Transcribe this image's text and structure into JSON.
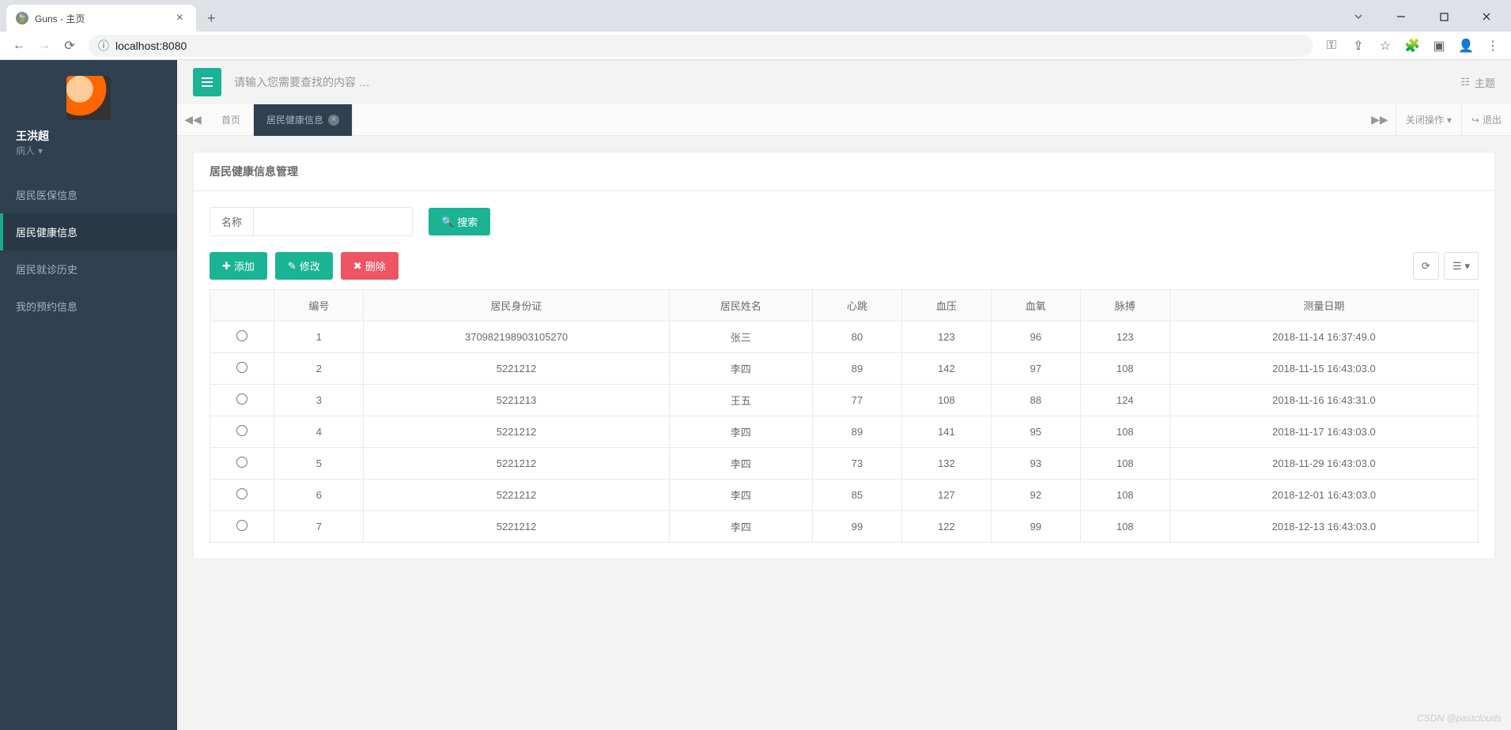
{
  "browser": {
    "tab_title": "Guns - 主页",
    "url": "localhost:8080"
  },
  "sidebar": {
    "username": "王洪超",
    "role": "病人",
    "items": [
      {
        "label": "居民医保信息",
        "active": false
      },
      {
        "label": "居民健康信息",
        "active": true
      },
      {
        "label": "居民就诊历史",
        "active": false
      },
      {
        "label": "我的预约信息",
        "active": false
      }
    ]
  },
  "topbar": {
    "search_placeholder": "请输入您需要查找的内容 …",
    "theme_label": "主题"
  },
  "tabs": {
    "home_label": "首页",
    "active_label": "居民健康信息",
    "close_ops_label": "关闭操作",
    "logout_label": "退出"
  },
  "panel": {
    "title": "居民健康信息管理",
    "search_label": "名称",
    "search_button": "搜索",
    "add_button": "添加",
    "edit_button": "修改",
    "delete_button": "删除"
  },
  "table": {
    "headers": [
      "编号",
      "居民身份证",
      "居民姓名",
      "心跳",
      "血压",
      "血氧",
      "脉搏",
      "测量日期"
    ],
    "rows": [
      {
        "id": "1",
        "idcard": "370982198903105270",
        "name": "张三",
        "heart": "80",
        "bp": "123",
        "spo2": "96",
        "pulse": "123",
        "date": "2018-11-14 16:37:49.0"
      },
      {
        "id": "2",
        "idcard": "5221212",
        "name": "李四",
        "heart": "89",
        "bp": "142",
        "spo2": "97",
        "pulse": "108",
        "date": "2018-11-15 16:43:03.0"
      },
      {
        "id": "3",
        "idcard": "5221213",
        "name": "王五",
        "heart": "77",
        "bp": "108",
        "spo2": "88",
        "pulse": "124",
        "date": "2018-11-16 16:43:31.0"
      },
      {
        "id": "4",
        "idcard": "5221212",
        "name": "李四",
        "heart": "89",
        "bp": "141",
        "spo2": "95",
        "pulse": "108",
        "date": "2018-11-17 16:43:03.0"
      },
      {
        "id": "5",
        "idcard": "5221212",
        "name": "李四",
        "heart": "73",
        "bp": "132",
        "spo2": "93",
        "pulse": "108",
        "date": "2018-11-29 16:43:03.0"
      },
      {
        "id": "6",
        "idcard": "5221212",
        "name": "李四",
        "heart": "85",
        "bp": "127",
        "spo2": "92",
        "pulse": "108",
        "date": "2018-12-01 16:43:03.0"
      },
      {
        "id": "7",
        "idcard": "5221212",
        "name": "李四",
        "heart": "99",
        "bp": "122",
        "spo2": "99",
        "pulse": "108",
        "date": "2018-12-13 16:43:03.0"
      }
    ]
  },
  "watermark": "CSDN @pastclouds"
}
